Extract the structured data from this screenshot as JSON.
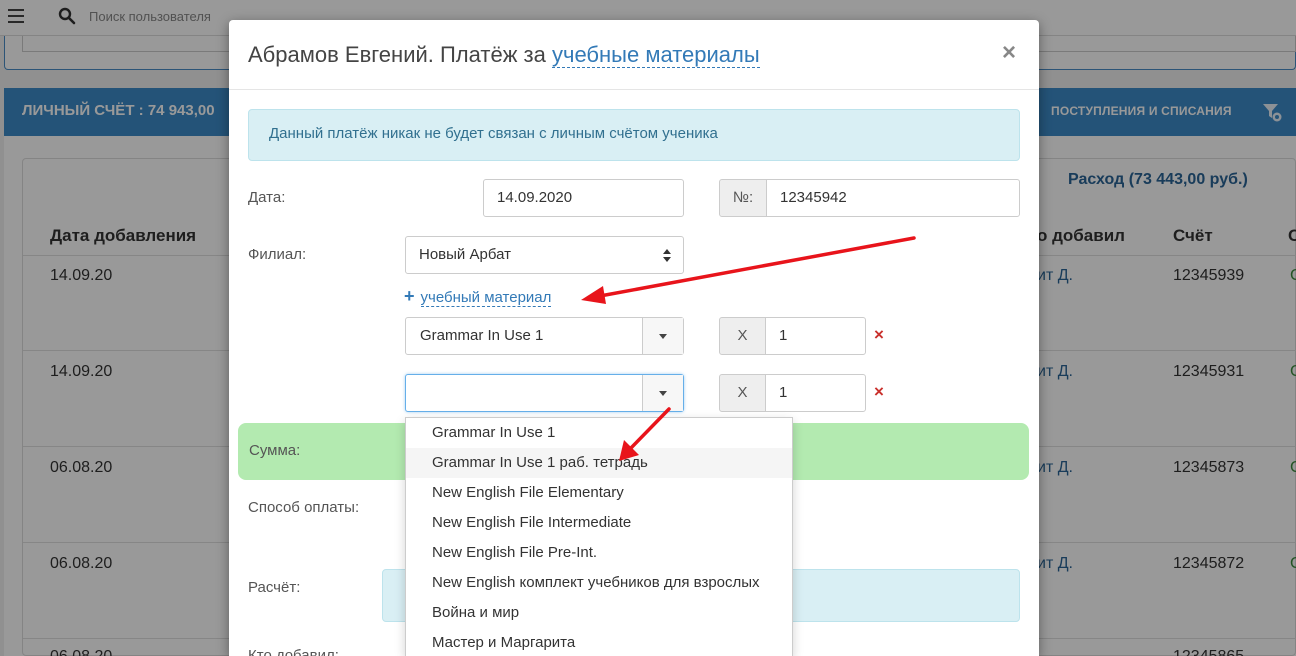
{
  "topbar": {
    "search_placeholder": "Поиск пользователя"
  },
  "account": {
    "label": "ЛИЧНЫЙ СЧЁТ : 74 943,00",
    "inout_label": "ПОСТУПЛЕНИЯ И СПИСАНИЯ"
  },
  "table": {
    "expense_label": "Расход (73 443,00 руб.)",
    "headers": {
      "date": "Дата добавления",
      "added_by": "о добавил",
      "account": "Счёт",
      "extra": "С"
    },
    "rows": [
      {
        "date": "14.09.20",
        "user": "ит Д.",
        "account": "12345939",
        "extra": "С"
      },
      {
        "date": "14.09.20",
        "user": "ит Д.",
        "account": "12345931",
        "extra": "С"
      },
      {
        "date": "06.08.20",
        "user": "ит Д.",
        "account": "12345873",
        "extra": "С"
      },
      {
        "date": "06.08.20",
        "user": "ит Д.",
        "account": "12345872",
        "extra": "С"
      },
      {
        "date": "06.08.20",
        "user": "",
        "account": "12345865",
        "extra": ""
      }
    ]
  },
  "modal": {
    "title": "Абрамов Евгений. Платёж за ",
    "title_link": "учебные материалы",
    "close": "×",
    "alert": "Данный платёж никак не будет связан с личным счётом ученика",
    "date_label": "Дата:",
    "date_value": "14.09.2020",
    "number_addon": "№:",
    "number_value": "12345942",
    "branch_label": "Филиал:",
    "branch_value": "Новый Арбат",
    "add_material": "учебный материал",
    "add_plus": "+",
    "materials": [
      {
        "value": "Grammar In Use 1",
        "times": "X",
        "qty": "1",
        "remove": "×"
      },
      {
        "value": "",
        "times": "X",
        "qty": "1",
        "remove": "×"
      }
    ],
    "sum_label": "Сумма:",
    "payment_method_label": "Способ оплаты:",
    "calc_label": "Расчёт:",
    "added_by_label": "Кто добавил:"
  },
  "dropdown": {
    "options": [
      "Grammar In Use 1",
      "Grammar In Use 1 раб. тетрадь",
      "New English File Elementary",
      "New English File Intermediate",
      "New English File Pre-Int.",
      "New English комплект учебников для взрослых",
      "Война и мир",
      "Мастер и Маргарита"
    ],
    "highlighted_index": 1
  },
  "colors": {
    "primary": "#337ab7",
    "panel": "#3d8bc9",
    "success_bg": "#b3eab0",
    "info_bg": "#d9eff4",
    "danger": "#c9302c",
    "arrow": "#e8141b"
  }
}
